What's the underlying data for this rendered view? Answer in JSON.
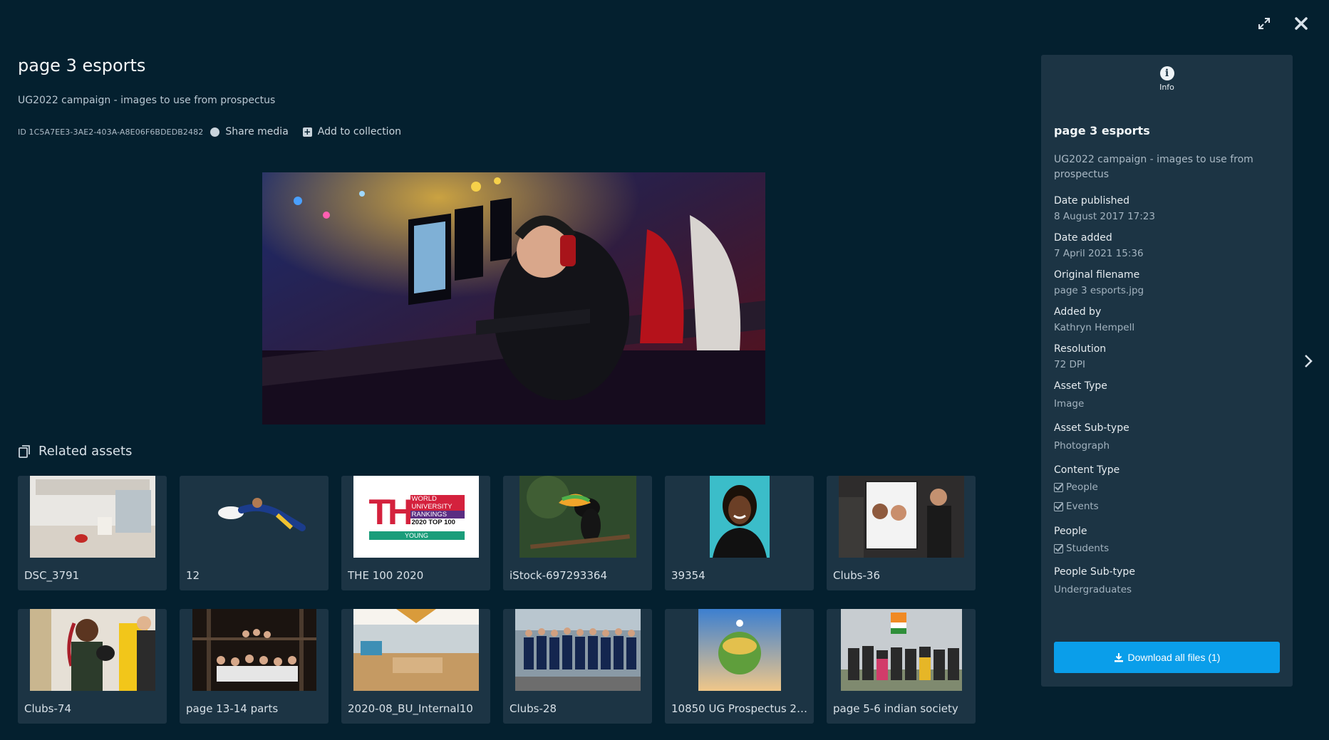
{
  "controls": {
    "expand_icon": "expand-icon",
    "close_icon": "close-icon"
  },
  "asset": {
    "title": "page 3 esports",
    "description": "UG2022 campaign - images to use from prospectus",
    "id_text": "ID 1C5A7EE3-3AE2-403A-A8E06F6BDEDB2482",
    "share_label": "Share media",
    "add_collection_label": "Add to collection"
  },
  "related": {
    "heading": "Related assets",
    "items": [
      {
        "label": "DSC_3791"
      },
      {
        "label": "12"
      },
      {
        "label": "THE 100 2020"
      },
      {
        "label": "iStock-697293364"
      },
      {
        "label": "39354"
      },
      {
        "label": "Clubs-36"
      },
      {
        "label": "Clubs-74"
      },
      {
        "label": "page 13-14 parts"
      },
      {
        "label": "2020-08_BU_Internal10"
      },
      {
        "label": "Clubs-28"
      },
      {
        "label": "10850 UG Prospectus 2…"
      },
      {
        "label": "page 5-6 indian society"
      }
    ],
    "the_logo": {
      "big": "THE",
      "line1": "WORLD",
      "line2": "UNIVERSITY",
      "line3": "RANKINGS",
      "line4": "2020 TOP 100",
      "line5": "YOUNG"
    }
  },
  "panel": {
    "tab_label": "Info",
    "title": "page 3 esports",
    "description": "UG2022 campaign - images to use from prospectus",
    "fields": [
      {
        "label": "Date published",
        "value": "8 August 2017 17:23"
      },
      {
        "label": "Date added",
        "value": "7 April 2021 15:36"
      },
      {
        "label": "Original filename",
        "value": "page 3 esports.jpg"
      },
      {
        "label": "Added by",
        "value": "Kathryn Hempell"
      },
      {
        "label": "Resolution",
        "value": "72 DPI"
      },
      {
        "label": "Asset Type",
        "value": "Image"
      },
      {
        "label": "Asset Sub-type",
        "value": "Photograph"
      }
    ],
    "content_type_label": "Content Type",
    "content_type_values": [
      "People",
      "Events"
    ],
    "people_label": "People",
    "people_values": [
      "Students"
    ],
    "people_subtype_label": "People Sub-type",
    "people_subtype_value": "Undergraduates",
    "download_label": "Download all files (1)"
  },
  "colors": {
    "background": "#04202f",
    "panel": "#1c3444",
    "accent": "#0a9eea"
  }
}
